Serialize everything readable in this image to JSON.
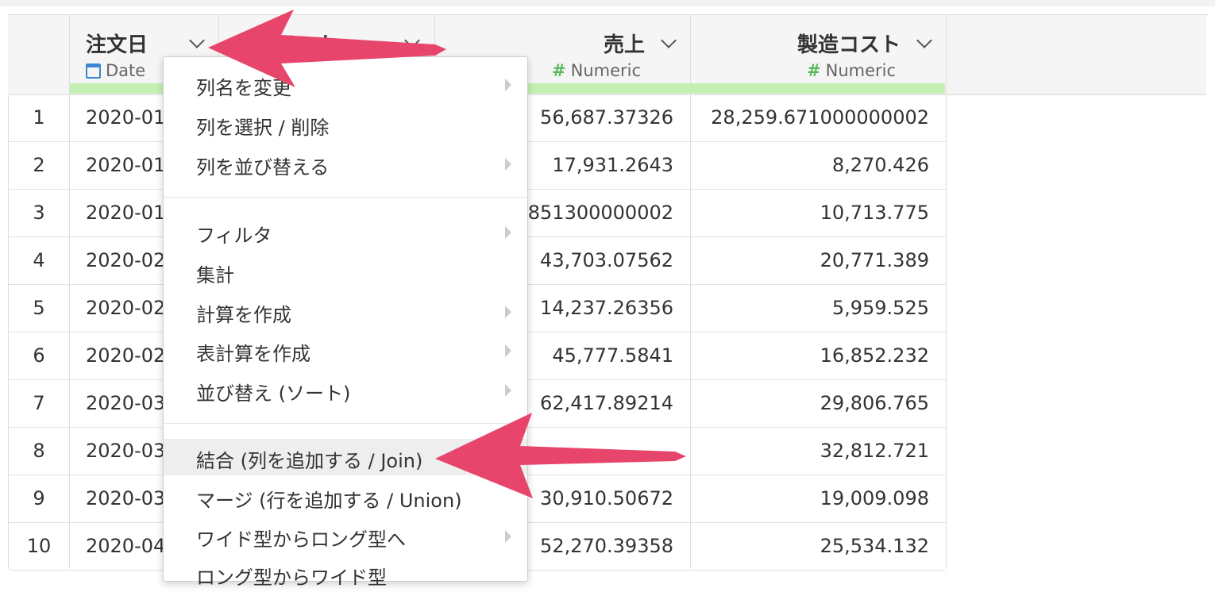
{
  "table": {
    "columns": [
      {
        "name": "注文日",
        "type": "Date"
      },
      {
        "name": "セグメント",
        "type": ""
      },
      {
        "name": "売上",
        "type": "Numeric"
      },
      {
        "name": "製造コスト",
        "type": "Numeric"
      }
    ],
    "rows": [
      {
        "num": "1",
        "date": "2020-01",
        "sales": "56,687.37326",
        "cost": "28,259.671000000002"
      },
      {
        "num": "2",
        "date": "2020-01",
        "sales": "17,931.2643",
        "cost": "8,270.426"
      },
      {
        "num": "3",
        "date": "2020-01",
        "sales": "851300000002",
        "cost": "10,713.775"
      },
      {
        "num": "4",
        "date": "2020-02",
        "sales": "43,703.07562",
        "cost": "20,771.389"
      },
      {
        "num": "5",
        "date": "2020-02",
        "sales": "14,237.26356",
        "cost": "5,959.525"
      },
      {
        "num": "6",
        "date": "2020-02",
        "sales": "45,777.5841",
        "cost": "16,852.232"
      },
      {
        "num": "7",
        "date": "2020-03",
        "sales": "62,417.89214",
        "cost": "29,806.765"
      },
      {
        "num": "8",
        "date": "2020-03",
        "sales": "",
        "cost": "32,812.721"
      },
      {
        "num": "9",
        "date": "2020-03",
        "sales": "30,910.50672",
        "cost": "19,009.098"
      },
      {
        "num": "10",
        "date": "2020-04",
        "sales": "52,270.39358",
        "cost": "25,534.132"
      }
    ]
  },
  "context_menu": {
    "items": [
      {
        "label": "列名を変更",
        "submenu": true
      },
      {
        "label": "列を選択 / 削除",
        "submenu": false
      },
      {
        "label": "列を並び替える",
        "submenu": true
      },
      {
        "label": "フィルタ",
        "submenu": true
      },
      {
        "label": "集計",
        "submenu": false
      },
      {
        "label": "計算を作成",
        "submenu": true
      },
      {
        "label": "表計算を作成",
        "submenu": true
      },
      {
        "label": "並び替え (ソート)",
        "submenu": true
      },
      {
        "label": "結合 (列を追加する / Join)",
        "submenu": false,
        "highlighted": true
      },
      {
        "label": "マージ (行を追加する / Union)",
        "submenu": false
      },
      {
        "label": "ワイド型からロング型へ",
        "submenu": true
      },
      {
        "label": "ロング型からワイド型",
        "submenu": false
      }
    ]
  },
  "annotations": {
    "arrow_color": "#e8456c"
  }
}
